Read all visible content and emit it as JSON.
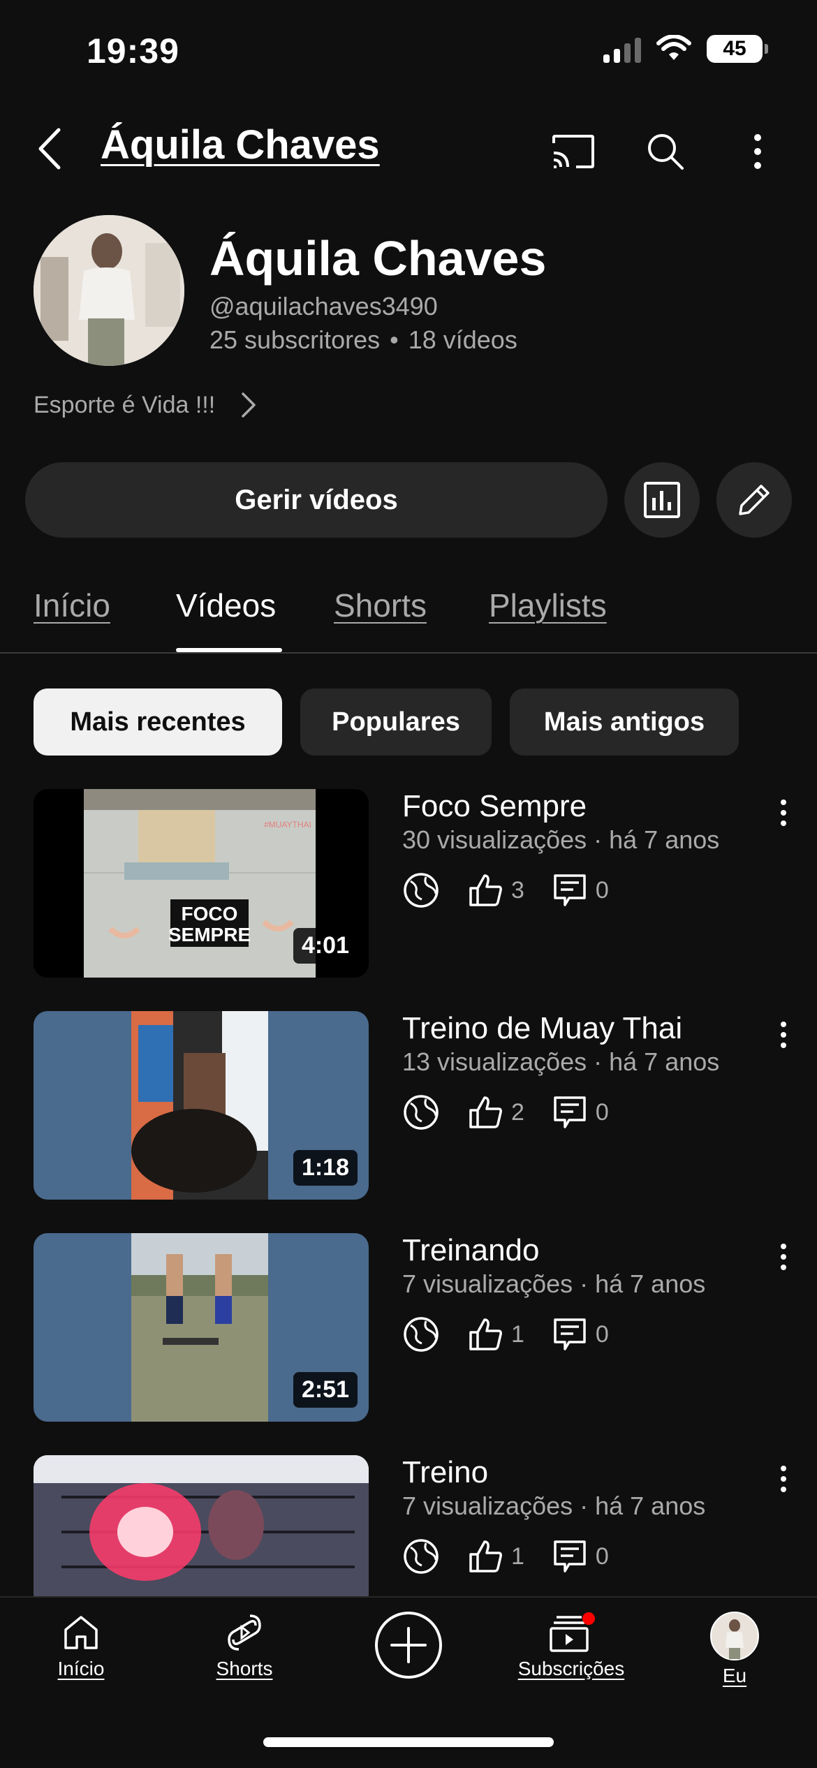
{
  "status_bar": {
    "time": "19:39",
    "battery": "45"
  },
  "app_bar": {
    "title": "Áquila Chaves",
    "icons": [
      "back-icon",
      "cast-icon",
      "search-icon",
      "more-vert-icon"
    ]
  },
  "channel": {
    "name": "Áquila Chaves",
    "handle": "@aquilachaves3490",
    "subscribers": "25 subscritores",
    "separator": "•",
    "videos_count": "18 vídeos",
    "description": "Esporte é Vida !!!"
  },
  "actions": {
    "manage_label": "Gerir vídeos",
    "icons": [
      "analytics-icon",
      "edit-icon"
    ]
  },
  "tabs": [
    {
      "label": "Início"
    },
    {
      "label": "Vídeos"
    },
    {
      "label": "Shorts"
    },
    {
      "label": "Playlists"
    }
  ],
  "active_tab": "Vídeos",
  "chips": [
    {
      "label": "Mais recentes"
    },
    {
      "label": "Populares"
    },
    {
      "label": "Mais antigos"
    }
  ],
  "selected_chip": "Mais recentes",
  "videos": [
    {
      "title": "Foco Sempre",
      "meta": "30 visualizações · há 7 anos",
      "likes": "3",
      "comments": "0",
      "duration": "4:01",
      "thumb_text_1": "FOCO",
      "thumb_text_2": "SEMPRE",
      "thumb_tag": "#MUAYTHAI"
    },
    {
      "title": "Treino de Muay Thai",
      "meta": "13 visualizações · há 7 anos",
      "likes": "2",
      "comments": "0",
      "duration": "1:18"
    },
    {
      "title": "Treinando",
      "meta": "7 visualizações · há 7 anos",
      "likes": "1",
      "comments": "0",
      "duration": "2:51"
    },
    {
      "title": "Treino",
      "meta": "7 visualizações · há 7 anos",
      "likes": "1",
      "comments": "0"
    }
  ],
  "bottom_nav": [
    {
      "label": "Início",
      "icon": "home-icon"
    },
    {
      "label": "Shorts",
      "icon": "shorts-icon"
    },
    {
      "label": "",
      "icon": "create-icon"
    },
    {
      "label": "Subscrições",
      "icon": "subscriptions-icon"
    },
    {
      "label": "Eu",
      "icon": "avatar"
    }
  ],
  "colors": {
    "background": "#0f0f0f",
    "surface": "#272727",
    "secondary_text": "#aaaaaa",
    "notification": "#ff0000"
  }
}
